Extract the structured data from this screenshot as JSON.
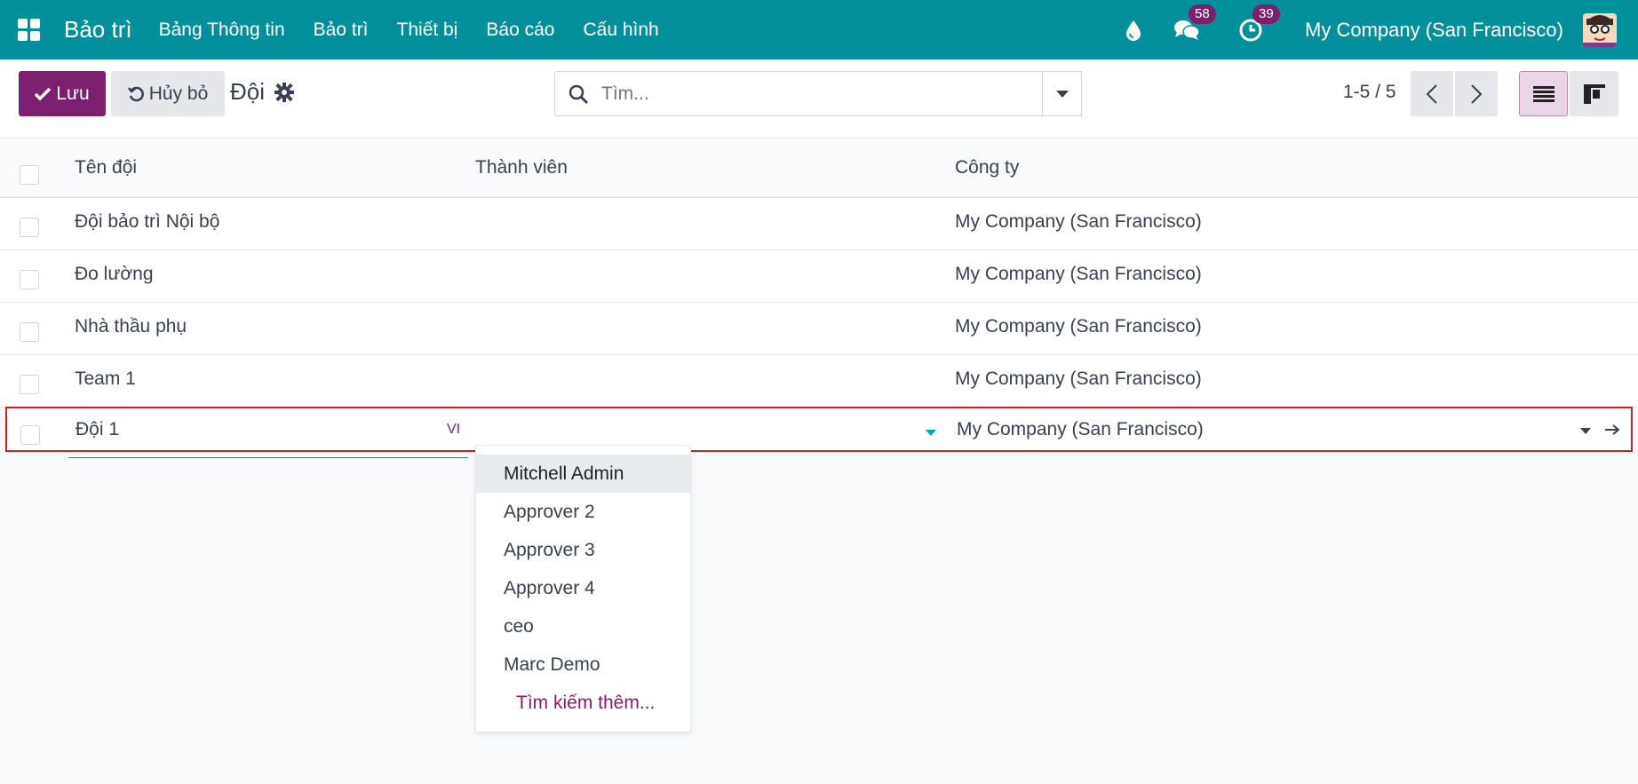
{
  "navbar": {
    "brand": "Bảo trì",
    "menu": [
      "Bảng Thông tin",
      "Bảo trì",
      "Thiết bị",
      "Báo cáo",
      "Cấu hình"
    ],
    "messages_count": "58",
    "activities_count": "39",
    "company": "My Company (San Francisco)",
    "accent": "#018f9c"
  },
  "control": {
    "save_label": "Lưu",
    "discard_label": "Hủy bỏ",
    "breadcrumb": "Đội",
    "search_placeholder": "Tìm...",
    "pager": "1-5 / 5",
    "primary_color": "#7c1f6f"
  },
  "table": {
    "headers": {
      "name": "Tên đội",
      "members": "Thành viên",
      "company": "Công ty"
    },
    "rows": [
      {
        "name": "Đội bảo trì Nội bộ",
        "company": "My Company (San Francisco)"
      },
      {
        "name": "Đo lường",
        "company": "My Company (San Francisco)"
      },
      {
        "name": "Nhà thầu phụ",
        "company": "My Company (San Francisco)"
      },
      {
        "name": "Team 1",
        "company": "My Company (San Francisco)"
      }
    ],
    "editing_row": {
      "name": "Đội 1",
      "lang": "VI",
      "company": "My Company (San Francisco)"
    }
  },
  "dropdown": {
    "items": [
      "Mitchell Admin",
      "Approver 2",
      "Approver 3",
      "Approver 4",
      "ceo",
      "Marc Demo"
    ],
    "search_more": "Tìm kiếm thêm..."
  }
}
